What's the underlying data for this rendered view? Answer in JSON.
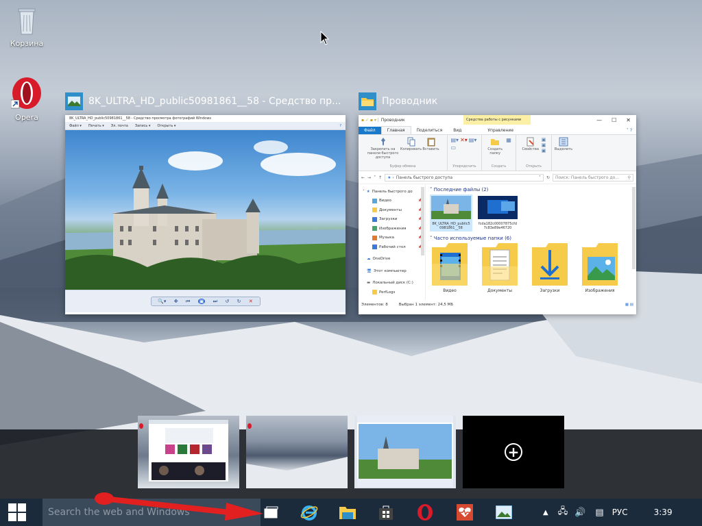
{
  "desktop": {
    "icons": [
      {
        "label": "Корзина"
      },
      {
        "label": "Opera"
      }
    ]
  },
  "task_view": {
    "windows": [
      {
        "title": "8K_ULTRA_HD_public50981861__58 - Средство пр...",
        "caption": "8K_ULTRA_HD_public50981861__58 - Средство просмотра фотографий Windows",
        "menu": [
          "Файл ▾",
          "Печать ▾",
          "Эл. почта",
          "Запись ▾",
          "Открыть ▾"
        ]
      },
      {
        "title": "Проводник",
        "titlebar_label": "Проводник",
        "tools_header": "Средства работы с рисунками",
        "tabs": [
          "Файл",
          "Главная",
          "Поделиться",
          "Вид",
          "Управление"
        ],
        "ribbon": {
          "pin_label": "Закрепить на панели быстрого доступа",
          "copy_label": "Копировать",
          "paste_label": "Вставить",
          "clipboard_group": "Буфер обмена",
          "organize_group": "Упорядочить",
          "new_folder_label": "Создать папку",
          "create_group": "Создать",
          "properties_label": "Свойства",
          "open_group": "Открыть",
          "select_label": "Выделить"
        },
        "address": "Панель быстрого доступа",
        "search_placeholder": "Поиск: Панель быстрого до...",
        "nav_items": [
          {
            "label": "Панель быстрого до",
            "pinned": false
          },
          {
            "label": "Видео",
            "pinned": true
          },
          {
            "label": "Документы",
            "pinned": true
          },
          {
            "label": "Загрузки",
            "pinned": true
          },
          {
            "label": "Изображения",
            "pinned": true
          },
          {
            "label": "Музыка",
            "pinned": true
          },
          {
            "label": "Рабочий стол",
            "pinned": true
          },
          {
            "label": "OneDrive",
            "pinned": false
          },
          {
            "label": "Этот компьютер",
            "pinned": false
          },
          {
            "label": "Локальный диск (C:)",
            "pinned": false
          },
          {
            "label": "PerfLogs",
            "pinned": false
          }
        ],
        "recent_header": "Последние файлы (2)",
        "recent_files": [
          {
            "name": "8K_ULTRA_HD_public50981861__58"
          },
          {
            "name": "fcda182c00007875cfd7c83e89e46720"
          }
        ],
        "frequent_header": "Часто используемые папки (6)",
        "folders": [
          "Видео",
          "Документы",
          "Загрузки",
          "Изображения"
        ],
        "status_items": "Элементов: 8",
        "status_selected": "Выбран 1 элемент: 24,5 МБ"
      }
    ],
    "new_desktop_symbol": "+"
  },
  "taskbar": {
    "search_placeholder": "Search the web and Windows",
    "apps": [
      "task-view",
      "internet-explorer",
      "file-explorer",
      "store",
      "opera",
      "health",
      "photos"
    ],
    "language": "РУС",
    "time": "3:39"
  }
}
